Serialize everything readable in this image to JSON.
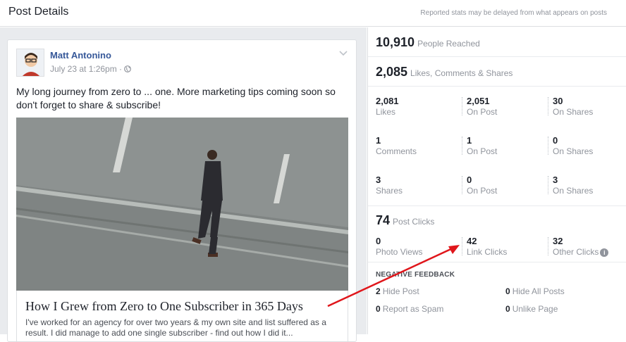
{
  "header": {
    "title": "Post Details",
    "note": "Reported stats may be delayed from what appears on posts"
  },
  "post": {
    "author": "Matt Antonino",
    "date": "July 23 at 1:26pm · ",
    "audience_icon": "globe-icon",
    "menu_icon": "chevron-down-icon",
    "text": "My long journey from zero to ... one. More marketing tips coming soon so don't forget to share & subscribe!",
    "link_title": "How I Grew from Zero to One Subscriber in 365 Days",
    "link_desc": "I've worked for an agency for over two years & my own site and list suffered as a result. I did manage to add one single subscriber - find out how I did it..."
  },
  "stats": {
    "reached": {
      "value": "10,910",
      "label": "People Reached"
    },
    "engagement": {
      "value": "2,085",
      "label": "Likes, Comments & Shares"
    },
    "likes": [
      {
        "value": "2,081",
        "label": "Likes"
      },
      {
        "value": "2,051",
        "label": "On Post"
      },
      {
        "value": "30",
        "label": "On Shares"
      }
    ],
    "comments": [
      {
        "value": "1",
        "label": "Comments"
      },
      {
        "value": "1",
        "label": "On Post"
      },
      {
        "value": "0",
        "label": "On Shares"
      }
    ],
    "shares": [
      {
        "value": "3",
        "label": "Shares"
      },
      {
        "value": "0",
        "label": "On Post"
      },
      {
        "value": "3",
        "label": "On Shares"
      }
    ],
    "clicks": {
      "value": "74",
      "label": "Post Clicks"
    },
    "click_breakdown": [
      {
        "value": "0",
        "label": "Photo Views"
      },
      {
        "value": "42",
        "label": "Link Clicks"
      },
      {
        "value": "32",
        "label": "Other Clicks"
      }
    ],
    "info_icon": "info-icon",
    "negative": {
      "title": "NEGATIVE FEEDBACK",
      "items": [
        {
          "value": "2",
          "label": "Hide Post"
        },
        {
          "value": "0",
          "label": "Hide All Posts"
        },
        {
          "value": "0",
          "label": "Report as Spam"
        },
        {
          "value": "0",
          "label": "Unlike Page"
        }
      ]
    }
  },
  "colors": {
    "link": "#365899",
    "annotation_arrow": "#e0161b",
    "muted": "#90949c"
  }
}
